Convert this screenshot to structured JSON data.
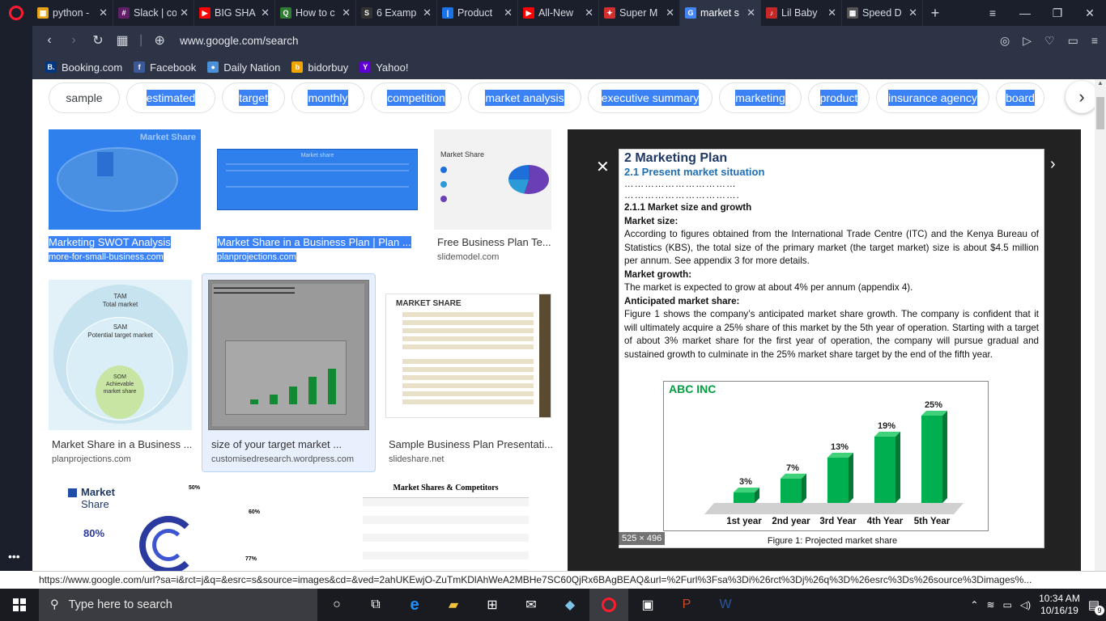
{
  "tabs": [
    {
      "label": "python -",
      "fav_color": "#e8a317",
      "glyph": "▦"
    },
    {
      "label": "Slack | co",
      "fav_color": "#611f69",
      "glyph": "#"
    },
    {
      "label": "BIG SHA",
      "fav_color": "#ff0000",
      "glyph": "▶"
    },
    {
      "label": "How to c",
      "fav_color": "#2e7d32",
      "glyph": "Q"
    },
    {
      "label": "6 Examp",
      "fav_color": "#333333",
      "glyph": "S"
    },
    {
      "label": "Product",
      "fav_color": "#1a73e8",
      "glyph": "|"
    },
    {
      "label": "All-New",
      "fav_color": "#ff0000",
      "glyph": "▶"
    },
    {
      "label": "Super M",
      "fav_color": "#d32f2f",
      "glyph": "✦"
    },
    {
      "label": "market s",
      "fav_color": "#4285f4",
      "glyph": "G",
      "active": true
    },
    {
      "label": "Lil Baby",
      "fav_color": "#c62828",
      "glyph": "♪"
    },
    {
      "label": "Speed D",
      "fav_color": "#555555",
      "glyph": "▦"
    }
  ],
  "address": {
    "url": "www.google.com/search"
  },
  "bookmarks": [
    {
      "label": "Booking.com",
      "glyph": "B.",
      "color": "#003580"
    },
    {
      "label": "Facebook",
      "glyph": "f",
      "color": "#3b5998"
    },
    {
      "label": "Daily Nation",
      "glyph": "●",
      "color": "#4a90d9"
    },
    {
      "label": "bidorbuy",
      "glyph": "b",
      "color": "#f0a500"
    },
    {
      "label": "Yahoo!",
      "glyph": "Y",
      "color": "#5f01d1"
    }
  ],
  "chips": [
    "sample",
    "estimated",
    "target",
    "monthly",
    "competition",
    "market analysis",
    "executive summary",
    "marketing",
    "product",
    "insurance agency",
    "board"
  ],
  "results": [
    {
      "title": "Marketing SWOT Analysis",
      "source": "more-for-small-business.com",
      "thumb_label": "Market Share"
    },
    {
      "title": "Market Share in a Business Plan | Plan ...",
      "source": "planprojections.com",
      "thumb_label": "Market share"
    },
    {
      "title": "Free Business Plan Te...",
      "source": "slidemodel.com",
      "thumb_label": "Market Share"
    },
    {
      "title": "Market Share in a Business ...",
      "source": "planprojections.com",
      "tam": "TAM",
      "tam_sub": "Total market",
      "sam": "SAM",
      "sam_sub": "Potential target market",
      "som": "SOM",
      "som_sub": "Achievable market share"
    },
    {
      "title": "size of your target market ...",
      "source": "customisedresearch.wordpress.com"
    },
    {
      "title": "Sample Business Plan Presentati...",
      "source": "slideshare.net",
      "thumb_label": "MARKET SHARE"
    },
    {
      "thumb_label": "Market",
      "thumb_sub": "Share",
      "pct1": "80%",
      "pct2": "50%",
      "pct3": "60%",
      "pct4": "77%"
    },
    {
      "thumb_label": "Market Shares & Competitors"
    }
  ],
  "preview": {
    "image_size": "525 × 496",
    "heading": "2   Marketing Plan",
    "subheading": "2.1    Present market situation",
    "dots1": "……………………………",
    "dots2": "…………………………….",
    "section": "2.1.1  Market size and growth",
    "size_label": "Market size:",
    "size_text": "According to figures obtained from the International Trade Centre (ITC) and the Kenya Bureau of Statistics (KBS), the total size of the primary market (the target market) size is about $4.5 million per annum. See appendix 3 for more details.",
    "growth_label": "Market growth:",
    "growth_text": "The market is expected to grow at about 4% per annum (appendix 4).",
    "share_label": "Anticipated market share:",
    "share_text": "Figure 1 shows the company’s anticipated market share growth. The company is confident that it will ultimately acquire a 25% share of this market by the 5th year of operation. Starting with a target of about 3% market share for the first year of operation, the company will pursue gradual and sustained growth to culminate in the 25% market share target by the end of the fifth year.",
    "caption": "Figure 1: Projected market share"
  },
  "chart_data": {
    "type": "bar",
    "title": "ABC INC",
    "categories": [
      "1st year",
      "2nd year",
      "3rd Year",
      "4th Year",
      "5th Year"
    ],
    "values": [
      3,
      7,
      13,
      19,
      25
    ],
    "labels": [
      "3%",
      "7%",
      "13%",
      "19%",
      "25%"
    ],
    "ylim": [
      0,
      25
    ],
    "bar_color": "#00b050"
  },
  "status_url": "https://www.google.com/url?sa=i&rct=j&q=&esrc=s&source=images&cd=&ved=2ahUKEwjO-ZuTmKDlAhWeA2MBHe7SC60QjRx6BAgBEAQ&url=%2Furl%3Fsa%3Di%26rct%3Dj%26q%3D%26esrc%3Ds%26source%3Dimages%...",
  "taskbar": {
    "search_placeholder": "Type here to search",
    "time": "10:34 AM",
    "date": "10/16/19",
    "notifications": "9"
  }
}
